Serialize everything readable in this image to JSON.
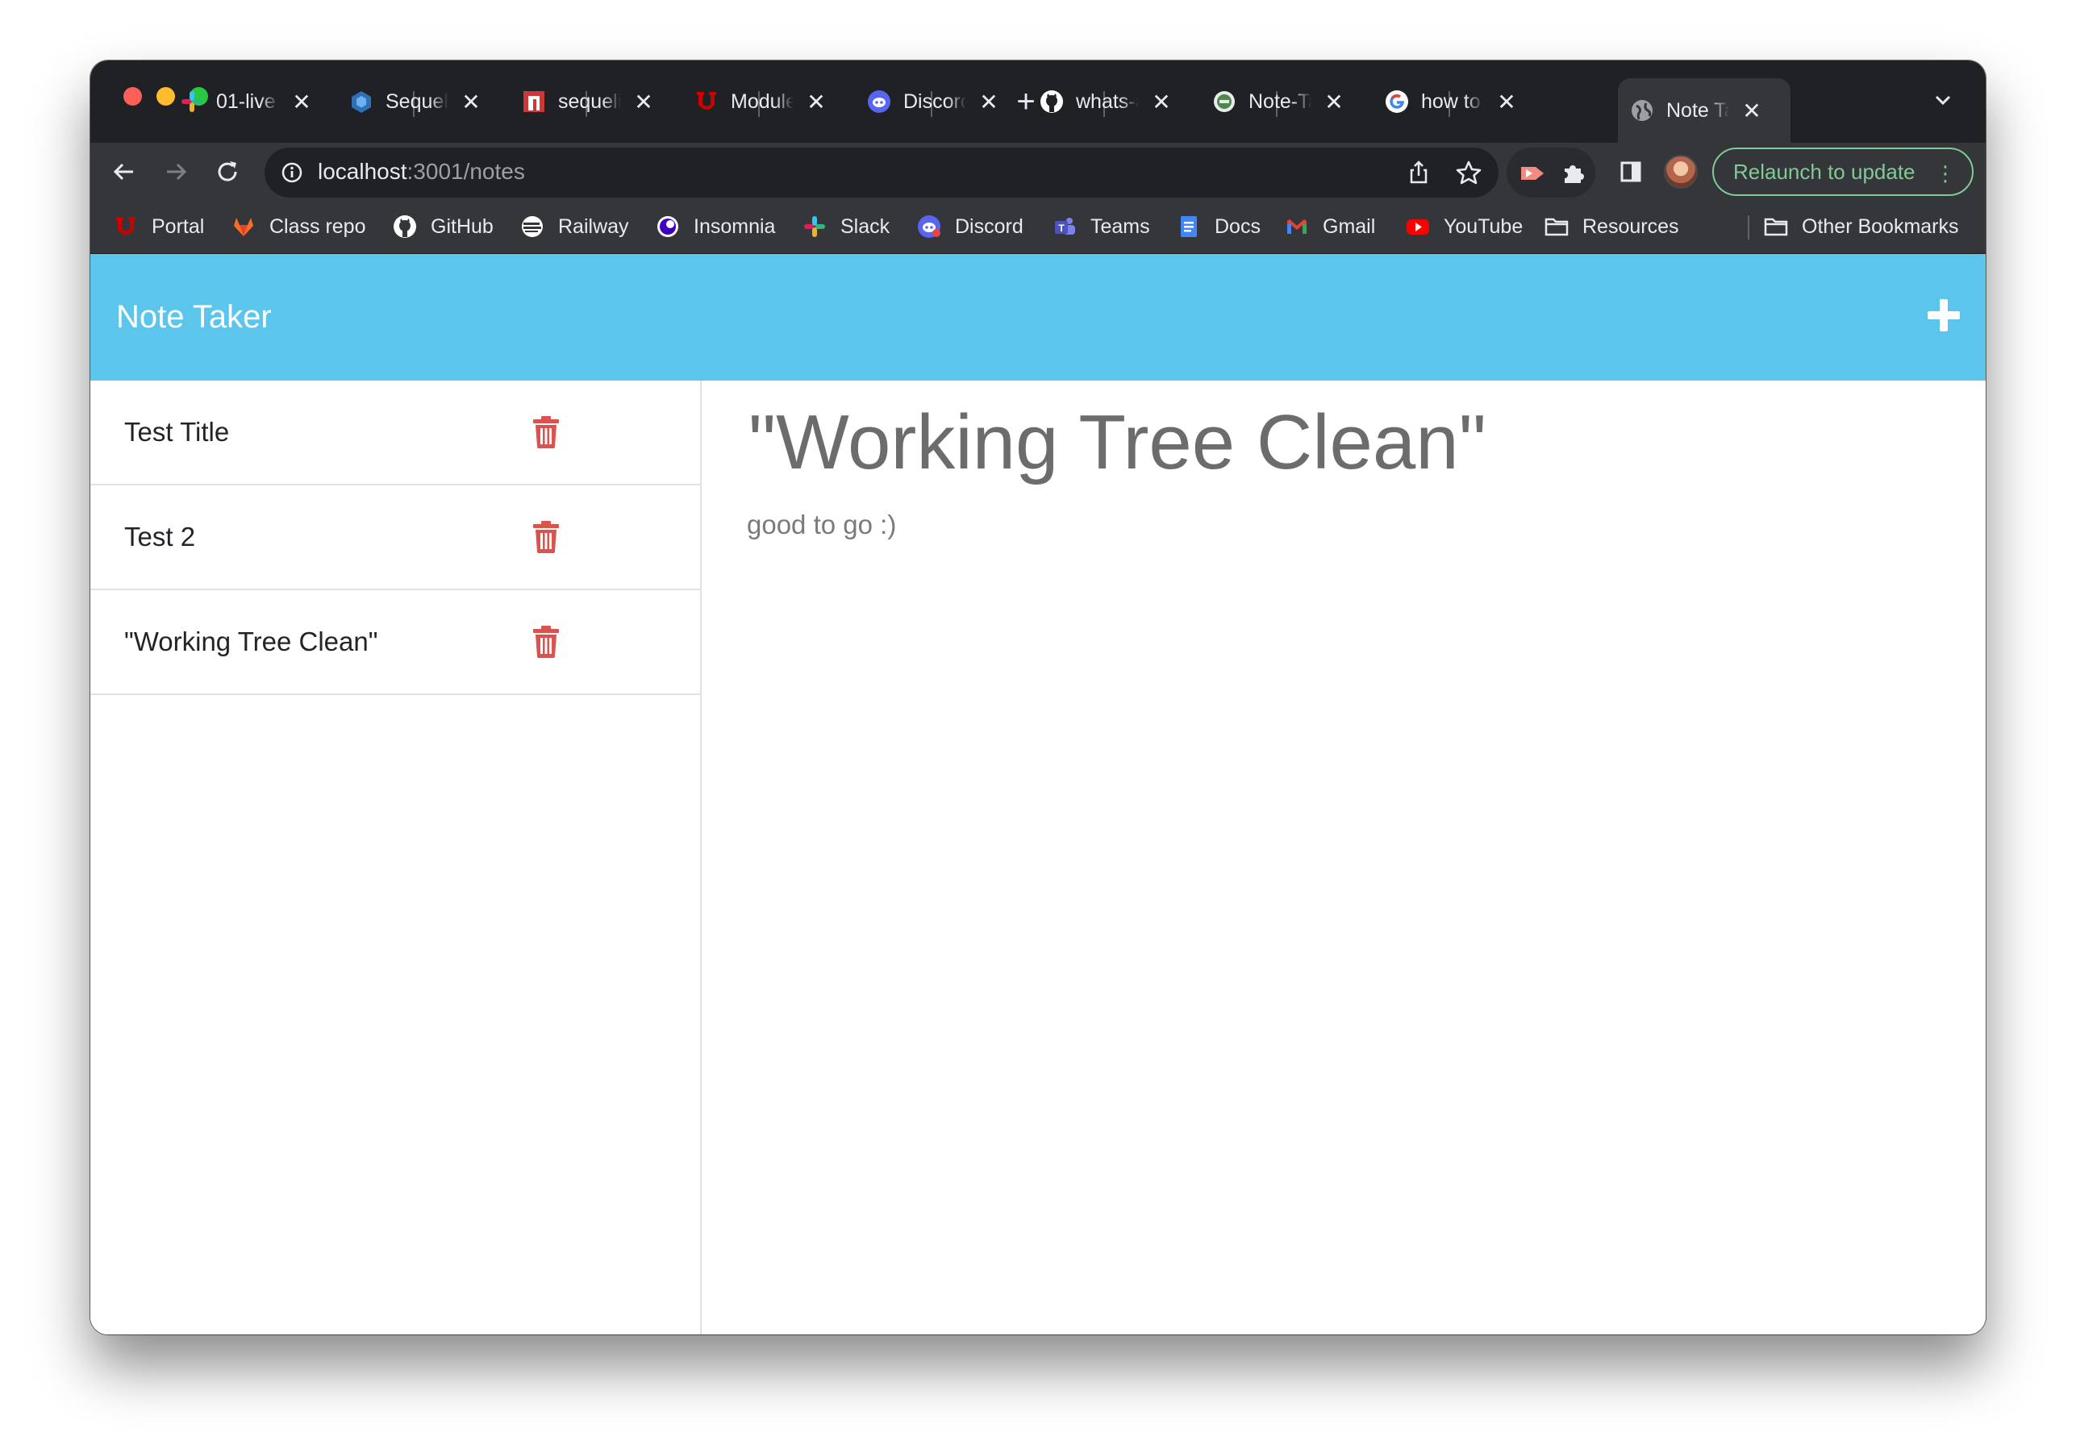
{
  "browser": {
    "tabs": [
      {
        "title": "01-live",
        "icon": "slack-icon"
      },
      {
        "title": "Sequeli",
        "icon": "sequelize-icon"
      },
      {
        "title": "sequeliz",
        "icon": "npm-icon"
      },
      {
        "title": "Module",
        "icon": "canvas-u-icon"
      },
      {
        "title": "Discord",
        "icon": "discord-icon"
      },
      {
        "title": "whats-a",
        "icon": "github-icon"
      },
      {
        "title": "Note-Ta",
        "icon": "note-taker-icon"
      },
      {
        "title": "how to",
        "icon": "google-icon"
      },
      {
        "title": "Note Ta",
        "icon": "globe-icon",
        "active": true
      }
    ],
    "close_glyph": "✕",
    "new_tab_glyph": "+",
    "url_host": "localhost",
    "url_path": ":3001/notes",
    "relaunch_label": "Relaunch to update",
    "bookmarks": [
      {
        "label": "Portal",
        "icon": "portal-u-icon"
      },
      {
        "label": "Class repo",
        "icon": "gitlab-icon"
      },
      {
        "label": "GitHub",
        "icon": "github-icon"
      },
      {
        "label": "Railway",
        "icon": "railway-icon"
      },
      {
        "label": "Insomnia",
        "icon": "insomnia-icon"
      },
      {
        "label": "Slack",
        "icon": "slack-icon"
      },
      {
        "label": "Discord",
        "icon": "discord-icon"
      },
      {
        "label": "Teams",
        "icon": "teams-icon"
      },
      {
        "label": "Docs",
        "icon": "docs-icon"
      },
      {
        "label": "Gmail",
        "icon": "gmail-icon"
      },
      {
        "label": "YouTube",
        "icon": "youtube-icon"
      },
      {
        "label": "Resources",
        "icon": "folder-icon"
      }
    ],
    "other_bookmarks": "Other Bookmarks"
  },
  "app": {
    "title": "Note Taker",
    "header_color": "#5bc5eb",
    "notes": [
      {
        "title": "Test Title"
      },
      {
        "title": "Test 2"
      },
      {
        "title": "\"Working Tree Clean\""
      }
    ],
    "active_note": {
      "title": "\"Working Tree Clean\"",
      "text": "good to go :)"
    },
    "delete_color": "#d9534f"
  }
}
